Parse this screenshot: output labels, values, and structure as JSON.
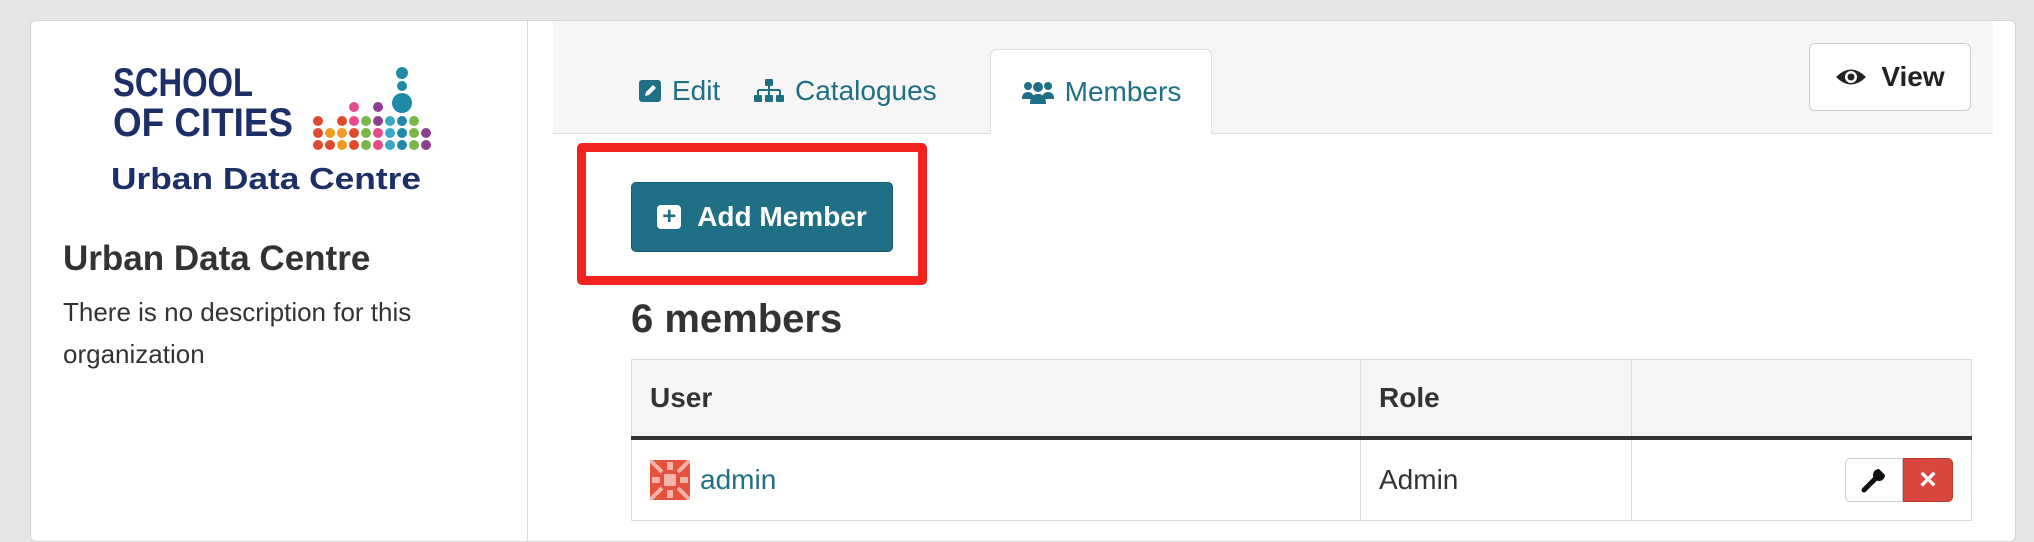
{
  "organization": {
    "logo": {
      "line1": "SCHOOL",
      "line2": "OF CITIES",
      "subtitle": "Urban Data Centre"
    },
    "title": "Urban Data Centre",
    "description": "There is no description for this organization"
  },
  "tabs": [
    {
      "label": "Edit",
      "icon": "edit-icon",
      "active": false
    },
    {
      "label": "Catalogues",
      "icon": "sitemap-icon",
      "active": false
    },
    {
      "label": "Members",
      "icon": "users-icon",
      "active": true
    }
  ],
  "view_button": {
    "label": "View",
    "icon": "eye-icon"
  },
  "add_member_button": {
    "label": "Add Member",
    "icon": "plus-square-icon"
  },
  "members_count_label": "6 members",
  "table": {
    "headers": [
      "User",
      "Role",
      ""
    ],
    "rows": [
      {
        "user": "admin",
        "role": "Admin"
      }
    ]
  },
  "colors": {
    "accent": "#1f6f86",
    "highlight": "#f2221c",
    "danger": "#d9463d",
    "logo_navy": "#1c2f67"
  }
}
